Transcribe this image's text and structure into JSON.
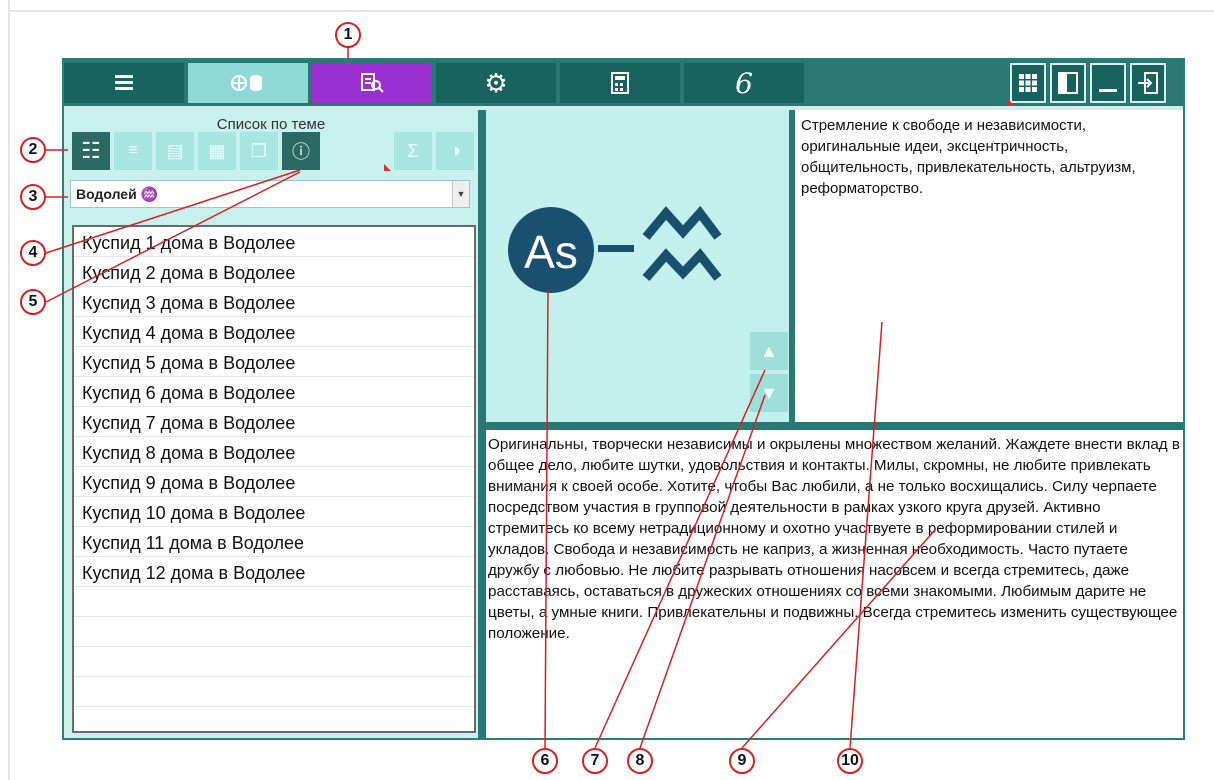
{
  "toolbar": {
    "buttons": [
      {
        "icon": "menu-icon"
      },
      {
        "icon": "globe-database-icon"
      },
      {
        "icon": "book-search-icon"
      },
      {
        "icon": "gear-icon"
      },
      {
        "icon": "calculator-icon"
      },
      {
        "icon": "logo-icon",
        "glyph": "6"
      }
    ],
    "window_buttons": [
      {
        "icon": "grid-icon"
      },
      {
        "icon": "panel-icon"
      },
      {
        "icon": "minimize-icon"
      },
      {
        "icon": "exit-icon"
      }
    ]
  },
  "left_panel": {
    "title": "Список по теме",
    "combo_value": "Водолей ♒",
    "list_items": [
      "Куспид 1 дома в Водолее",
      "Куспид 2 дома в Водолее",
      "Куспид 3 дома в Водолее",
      "Куспид 4 дома в Водолее",
      "Куспид 5 дома в Водолее",
      "Куспид 6 дома в Водолее",
      "Куспид 7 дома в Водолее",
      "Куспид 8 дома в Водолее",
      "Куспид 9 дома в Водолее",
      "Куспид 10 дома в Водолее",
      "Куспид 11 дома в Водолее",
      "Куспид 12 дома в Водолее"
    ]
  },
  "glyph": {
    "circle_text": "As"
  },
  "short_description": "Стремление к свободе и независимости, оригинальные идеи, эксцентричность, общительность, привлекательность, альтруизм, реформаторство.",
  "long_description": "Оригинальны, творчески независимы и окрылены множеством желаний. Жаждете внести вклад в общее дело, любите шутки, удовольствия и контакты. Милы, скромны, не любите привлекать внимания к своей особе. Хотите, чтобы Вас любили, а не только восхищались. Силу черпаете посредством участия в групповой деятельности в рамках узкого круга друзей. Активно стремитесь ко всему нетрадиционному и охотно участвуете в реформировании стилей и укладов. Свобода и независимость не каприз, а жизненная необходимость. Часто путаете дружбу с любовью. Не любите разрывать отношения насовсем и всегда стремитесь, даже расставаясь, оставаться в дружеских отношениях со всеми знакомыми. Любимым дарите не цветы, а умные книги. Привлекательны и подвижны. Всегда стремитесь изменить существующее положение.",
  "callouts": [
    "1",
    "2",
    "3",
    "4",
    "5",
    "6",
    "7",
    "8",
    "9",
    "10"
  ],
  "colors": {
    "teal": "#2b7873",
    "accent_purple": "#9b2fd1",
    "callout_red": "#d82020",
    "panel_bg": "#c8f0ec"
  }
}
